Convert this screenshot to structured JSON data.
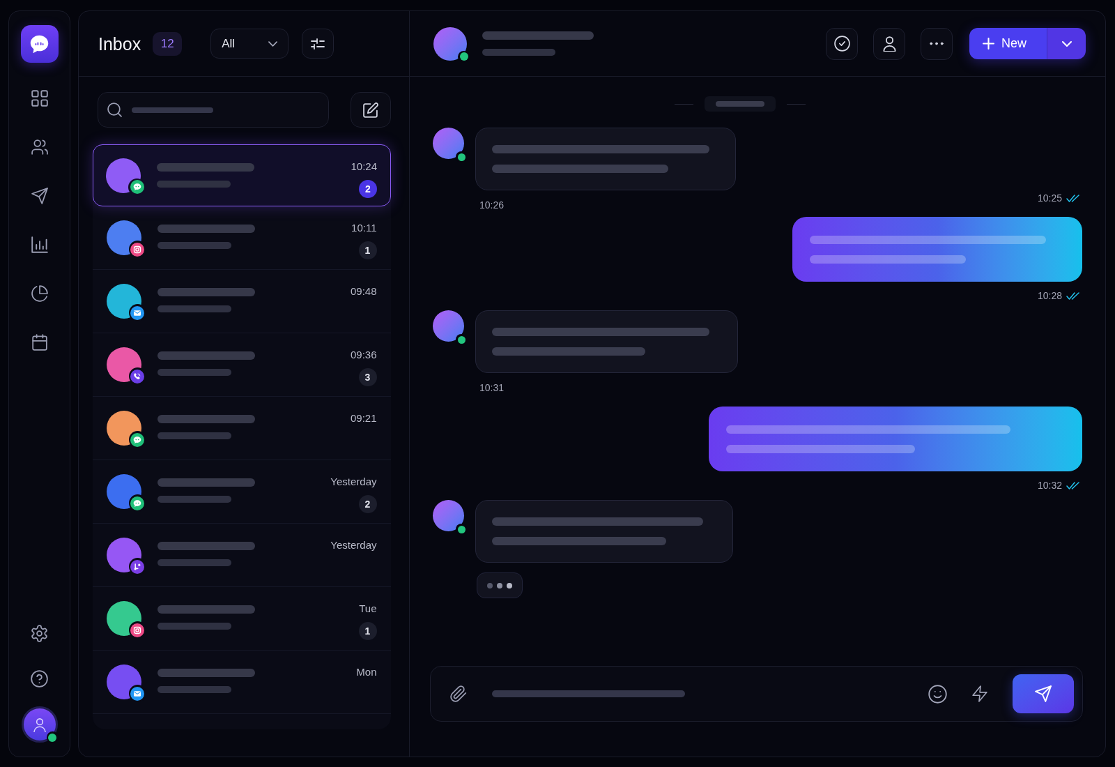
{
  "inbox": {
    "title": "Inbox",
    "count": "12",
    "filter": "All"
  },
  "conversations": [
    {
      "time": "10:24",
      "unread": "2",
      "selected": true,
      "kind": "chat",
      "color": "#8f5cf5"
    },
    {
      "time": "10:11",
      "unread": "1",
      "selected": false,
      "kind": "camera",
      "color": "#4d7ef1"
    },
    {
      "time": "09:48",
      "selected": false,
      "kind": "email",
      "color": "#23b6d9"
    },
    {
      "time": "09:36",
      "unread": "3",
      "selected": false,
      "kind": "phone",
      "color": "#ea58a6"
    },
    {
      "time": "09:21",
      "selected": false,
      "kind": "chat",
      "color": "#f2965c"
    },
    {
      "time": "Yesterday",
      "unread": "2",
      "selected": false,
      "kind": "chat",
      "color": "#3c6ef0"
    },
    {
      "time": "Yesterday",
      "selected": false,
      "kind": "branch",
      "color": "#9657f4"
    },
    {
      "time": "Tue",
      "unread": "1",
      "selected": false,
      "kind": "camera",
      "color": "#35c98f"
    },
    {
      "time": "Mon",
      "selected": false,
      "kind": "email",
      "color": "#774ef2"
    }
  ],
  "chat": {
    "contact": {
      "online": true
    },
    "new_button": {
      "label": "New"
    },
    "messages": [
      {
        "kind": "incoming",
        "time": "10:26",
        "online": true
      },
      {
        "kind": "receipt",
        "time": "10:25",
        "read": true
      },
      {
        "kind": "outgoing",
        "time": "10:28",
        "read": true
      },
      {
        "kind": "incoming",
        "time": "10:31",
        "online": true
      },
      {
        "kind": "outgoing",
        "time": "10:32",
        "read": true
      },
      {
        "kind": "incoming",
        "online": true
      },
      {
        "kind": "typing"
      }
    ]
  },
  "user": {
    "online": true
  }
}
